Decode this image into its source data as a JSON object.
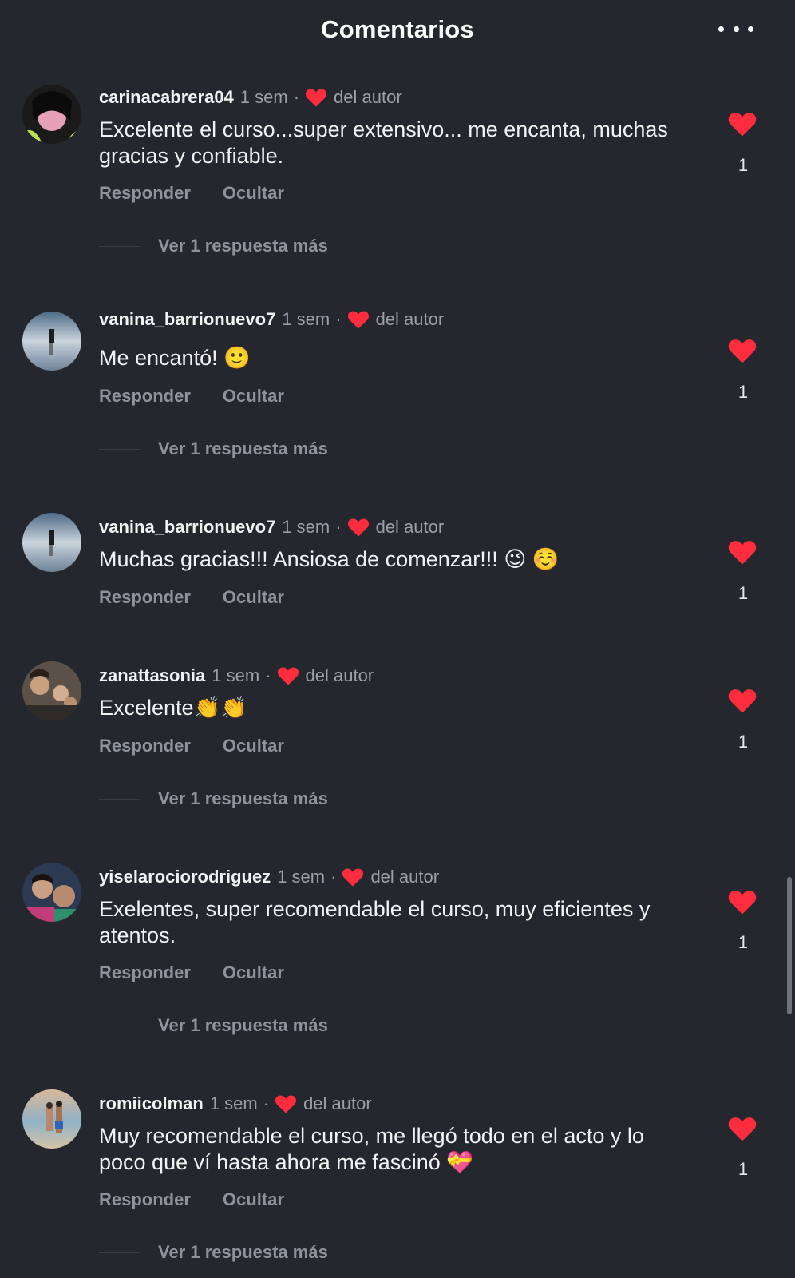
{
  "header": {
    "title": "Comentarios"
  },
  "actions": {
    "reply": "Responder",
    "hide": "Ocultar"
  },
  "comments": [
    {
      "username": "carinacabrera04",
      "time": "1 sem",
      "separator": "·",
      "author_like": "del autor",
      "text": "Excelente el curso...super extensivo... me encanta, muchas gracias y confiable.",
      "likes": "1",
      "replies": "Ver 1 respuesta más"
    },
    {
      "username": "vanina_barrionuevo7",
      "time": "1 sem",
      "separator": "·",
      "author_like": "del autor",
      "text": "Me encantó! 🙂",
      "likes": "1",
      "replies": "Ver 1 respuesta más"
    },
    {
      "username": "vanina_barrionuevo7",
      "time": "1 sem",
      "separator": "·",
      "author_like": "del autor",
      "text": "Muchas gracias!!! Ansiosa de comenzar!!! 😉 ☺️",
      "likes": "1",
      "replies": ""
    },
    {
      "username": "zanattasonia",
      "time": "1 sem",
      "separator": "·",
      "author_like": "del autor",
      "text": "Excelente👏👏",
      "likes": "1",
      "replies": "Ver 1 respuesta más"
    },
    {
      "username": "yiselarociorodriguez",
      "time": "1 sem",
      "separator": "·",
      "author_like": "del autor",
      "text": "Exelentes, super recomendable el curso, muy eficientes y atentos.",
      "likes": "1",
      "replies": "Ver 1 respuesta más"
    },
    {
      "username": "romiicolman",
      "time": "1 sem",
      "separator": "·",
      "author_like": "del autor",
      "text": "Muy recomendable el curso, me llegó todo en el acto y lo poco que ví hasta ahora me fascinó 💝",
      "likes": "1",
      "replies": "Ver 1 respuesta más"
    }
  ],
  "colors": {
    "background": "#24272d",
    "heart": "#ff2d3d",
    "muted": "#8d939b"
  },
  "icons": {
    "heart": "heart-icon",
    "more": "more-options-icon"
  }
}
